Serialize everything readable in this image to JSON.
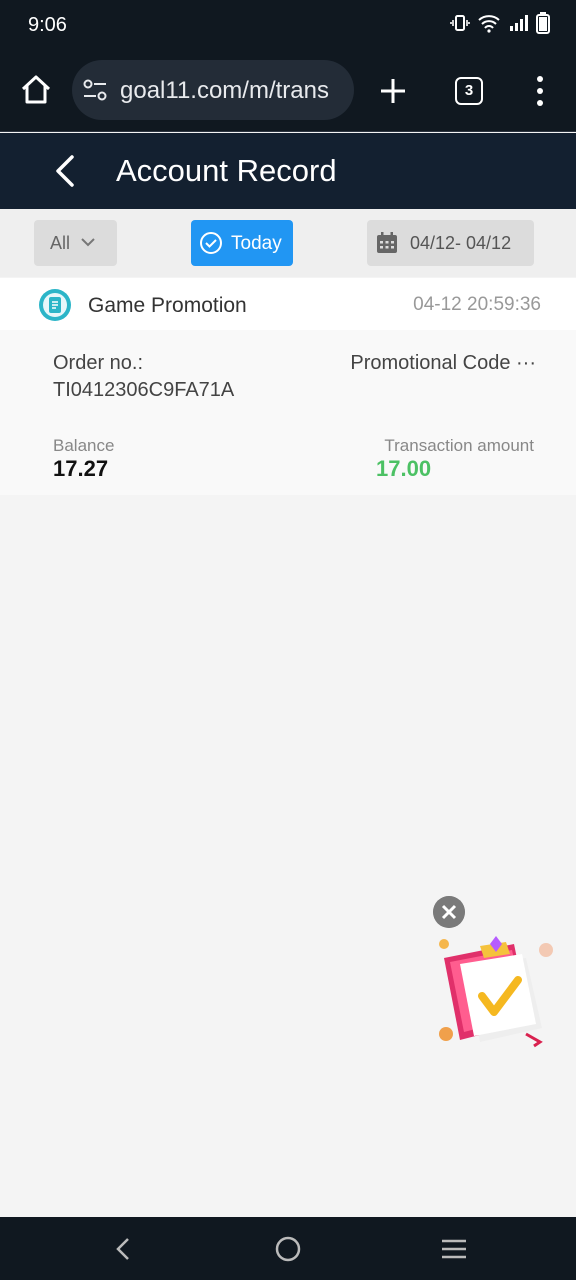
{
  "status_bar": {
    "time": "9:06"
  },
  "browser": {
    "url": "goal11.com/m/trans",
    "tab_count": "3"
  },
  "header": {
    "title": "Account Record"
  },
  "filters": {
    "type": "All",
    "range": "Today",
    "date_range": "04/12- 04/12"
  },
  "record": {
    "type": "Game Promotion",
    "time": "04-12 20:59:36",
    "order_label": "Order no.:",
    "order_no": "TI0412306C9FA71A",
    "description": "Promotional Code ···",
    "balance_label": "Balance",
    "balance": "17.27",
    "amount_label": "Transaction amount",
    "amount": "17.00"
  },
  "colors": {
    "accent": "#2196f3",
    "amount": "#4cc164",
    "header": "#132030"
  }
}
